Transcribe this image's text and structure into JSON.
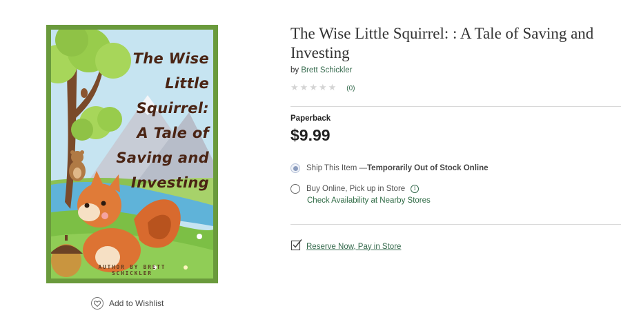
{
  "cover": {
    "title_lines": [
      "The Wise",
      "Little",
      "Squirrel:",
      "A Tale of",
      "Saving and",
      "Investing"
    ],
    "author_lines": [
      "AUTHOR BY BRETT",
      "SCHICKLER"
    ],
    "colors": {
      "frame": "#6a9a3c",
      "title_text": "#4a2414"
    }
  },
  "wishlist": {
    "label": "Add to Wishlist",
    "icon": "heart-icon"
  },
  "product": {
    "title": "The Wise Little Squirrel: : A Tale of Saving and Investing",
    "by_prefix": "by",
    "author": "Brett Schickler",
    "rating": {
      "stars": 0,
      "max": 5,
      "count": "(0)",
      "icon": "star-icon"
    },
    "format": "Paperback",
    "price": "$9.99"
  },
  "fulfillment": {
    "ship": {
      "label": "Ship This Item — ",
      "status": "Temporarily Out of Stock Online",
      "selected": true
    },
    "pickup": {
      "label": "Buy Online, Pick up in Store",
      "info_icon": "info-icon",
      "selected": false
    },
    "check_availability": "Check Availability at Nearby Stores",
    "reserve": {
      "label": "Reserve Now, Pay in Store",
      "icon": "checklist-icon"
    }
  },
  "colors": {
    "link_green": "#356a4d",
    "divider": "#d8d8d8"
  }
}
